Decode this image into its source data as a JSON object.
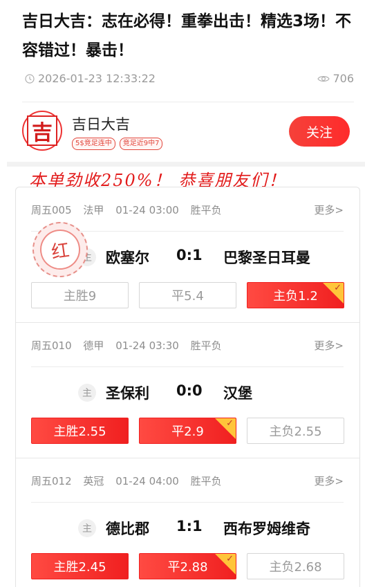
{
  "article": {
    "title": "吉日大吉：志在必得！重拳出击！精选3场！不容错过！暴击！",
    "time": "2026-01-23 12:33:22",
    "views": "706"
  },
  "author": {
    "avatar_char": "吉",
    "name": "吉日大吉",
    "badges": [
      "5$竞足连中",
      "竞足近9中7"
    ],
    "follow_label": "关注"
  },
  "banner": "本单劲收250%！ 恭喜朋友们！",
  "stamp_text": "红",
  "more_label": "更多>",
  "home_tag": "主",
  "matches": [
    {
      "code": "周五005",
      "league": "法甲",
      "time": "01-24 03:00",
      "play": "胜平负",
      "home": "欧塞尔",
      "score": "0:1",
      "away": "巴黎圣日耳曼",
      "odds": [
        {
          "label": "主胜9",
          "selected": false
        },
        {
          "label": "平5.4",
          "selected": false
        },
        {
          "label": "主负1.2",
          "selected": true
        }
      ]
    },
    {
      "code": "周五010",
      "league": "德甲",
      "time": "01-24 03:30",
      "play": "胜平负",
      "home": "圣保利",
      "score": "0:0",
      "away": "汉堡",
      "odds": [
        {
          "label": "主胜2.55",
          "selected": true
        },
        {
          "label": "平2.9",
          "selected": true
        },
        {
          "label": "主负2.55",
          "selected": false
        }
      ]
    },
    {
      "code": "周五012",
      "league": "英冠",
      "time": "01-24 04:00",
      "play": "胜平负",
      "home": "德比郡",
      "score": "1:1",
      "away": "西布罗姆维奇",
      "odds": [
        {
          "label": "主胜2.45",
          "selected": true
        },
        {
          "label": "平2.88",
          "selected": true
        },
        {
          "label": "主负2.68",
          "selected": false
        }
      ]
    }
  ],
  "hit_marks": [
    [
      false,
      false,
      true
    ],
    [
      false,
      true,
      false
    ],
    [
      false,
      true,
      false
    ]
  ],
  "colors": {
    "accent": "#f02020",
    "hit_corner": "#ffc53a",
    "muted": "#9a9a9a"
  }
}
